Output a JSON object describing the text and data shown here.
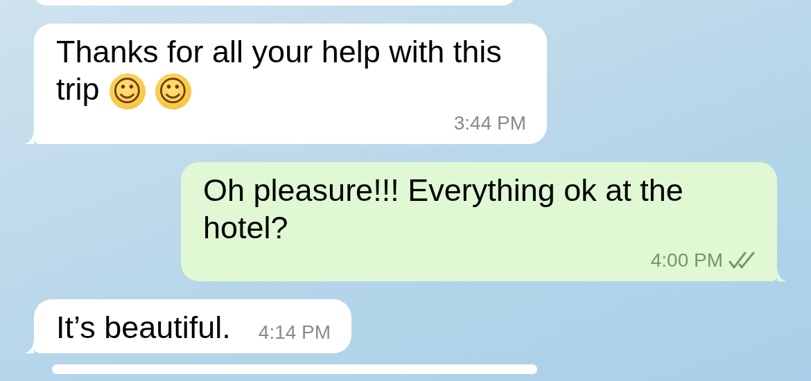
{
  "messages": [
    {
      "kind": "fragment",
      "outgoing": false
    },
    {
      "kind": "text",
      "outgoing": false,
      "text": "Thanks for all your help with this trip",
      "emojis": [
        "☺",
        "☺"
      ],
      "time": "3:44 PM"
    },
    {
      "kind": "text",
      "outgoing": true,
      "text": "Oh pleasure!!! Everything ok at the hotel?",
      "time": "4:00 PM",
      "read": true
    },
    {
      "kind": "text",
      "outgoing": false,
      "text": "It’s beautiful.",
      "time": "4:14 PM"
    },
    {
      "kind": "fragment",
      "outgoing": false
    }
  ]
}
